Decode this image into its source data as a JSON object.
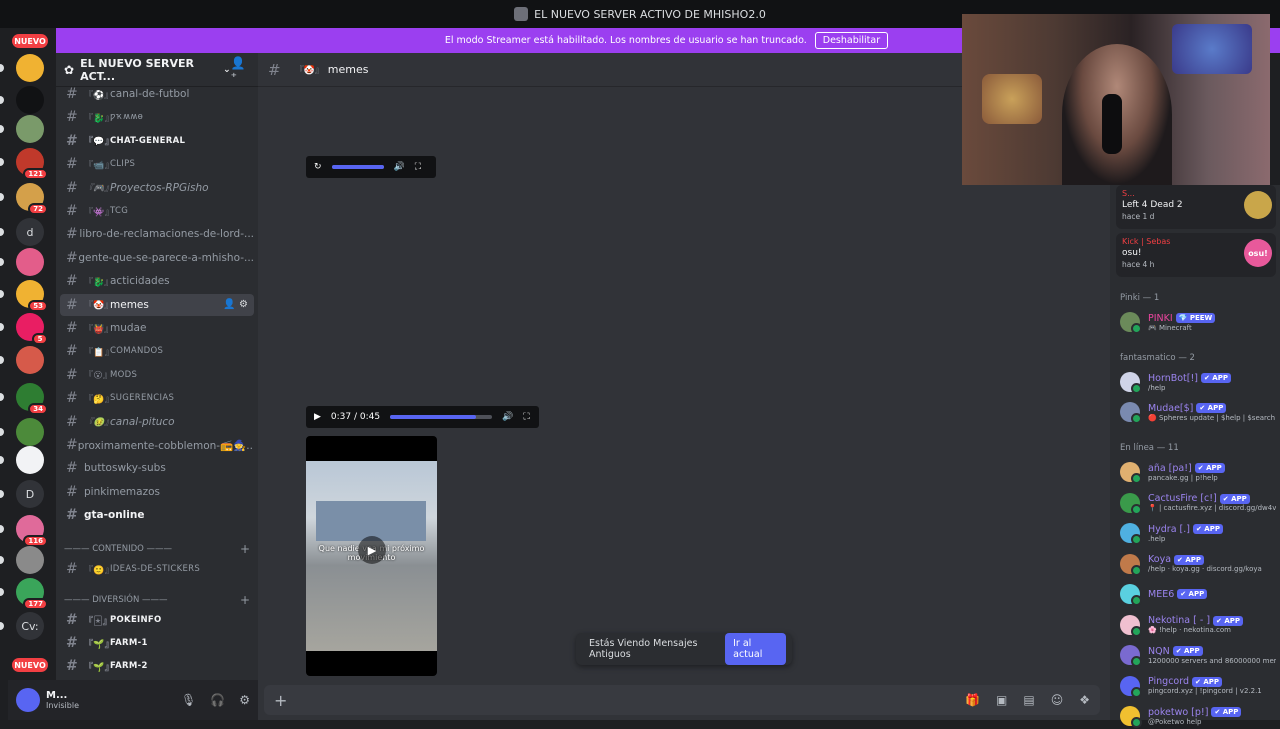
{
  "titlebar": {
    "title": "EL NUEVO SERVER ACTIVO DE MHISHO2.0"
  },
  "banner": {
    "text": "El modo Streamer está habilitado. Los nombres de usuario se han truncado.",
    "button": "Deshabilitar"
  },
  "rail": {
    "new_top": "NUEVO",
    "new_bottom": "NUEVO",
    "servers": [
      {
        "badge": "",
        "color": "#f0b232"
      },
      {
        "badge": "",
        "color": "#111214"
      },
      {
        "badge": "",
        "color": "#7a9a6a"
      },
      {
        "badge": "121",
        "color": "#c0392b"
      },
      {
        "badge": "72",
        "color": "#d4a04a"
      },
      {
        "badge": "",
        "letter": "d"
      },
      {
        "badge": "",
        "color": "#e35d8a"
      },
      {
        "badge": "53",
        "color": "#f0b232"
      },
      {
        "badge": "5",
        "color": "#e91e63"
      },
      {
        "badge": "",
        "color": "#d65a4a"
      },
      {
        "badge": "34",
        "color": "#2e7d32"
      },
      {
        "badge": "",
        "color": "#4c8a3a"
      },
      {
        "badge": "",
        "color": "#f2f3f5"
      },
      {
        "badge": "",
        "letter": "D"
      },
      {
        "badge": "116",
        "color": "#e06a9a"
      },
      {
        "badge": "",
        "color": "#8a8a8a"
      },
      {
        "badge": "177",
        "color": "#3aa55a"
      },
      {
        "badge": "",
        "letter": "Cv:"
      }
    ]
  },
  "sidebar": {
    "guild_name": "EL NUEVO SERVER ACT...",
    "channels": [
      {
        "emoji": "『⚽』",
        "name": "canal-de-futbol",
        "style": ""
      },
      {
        "emoji": "『🐉』",
        "name": "ƿҡʍʍѳ",
        "style": "small"
      },
      {
        "emoji": "『💬』",
        "name": "CHAT-GENERAL",
        "style": "bold small"
      },
      {
        "emoji": "『📹』",
        "name": "CLIPS",
        "style": "small"
      },
      {
        "emoji": "『🎮』",
        "name": "Proyectos-RPGisho",
        "style": "ital"
      },
      {
        "emoji": "『👾』",
        "name": "TCG",
        "style": "small"
      },
      {
        "emoji": "",
        "name": "libro-de-reclamaciones-de-lord-...",
        "style": ""
      },
      {
        "emoji": "",
        "name": "gente-que-se-parece-a-mhisho-...",
        "style": ""
      },
      {
        "emoji": "『🐉』",
        "name": "acticidades",
        "style": ""
      },
      {
        "emoji": "『🤡』",
        "name": "memes",
        "style": "sel"
      },
      {
        "emoji": "『👹』",
        "name": "mudae",
        "style": ""
      },
      {
        "emoji": "『📋』",
        "name": "COMANDOS",
        "style": "small"
      },
      {
        "emoji": "『😮』",
        "name": "MODS",
        "style": "small"
      },
      {
        "emoji": "『🤔』",
        "name": "SUGERENCIAS",
        "style": "small"
      },
      {
        "emoji": "『🤢』",
        "name": "canal-pituco",
        "style": "ital"
      },
      {
        "emoji": "",
        "name": "proximamente-cobblemon-📻🧙...",
        "style": ""
      },
      {
        "emoji": "",
        "name": "buttoswky-subs",
        "style": ""
      },
      {
        "emoji": "",
        "name": "pinkimemazos",
        "style": ""
      },
      {
        "emoji": "",
        "name": "gta-online",
        "style": "bold"
      }
    ],
    "category_contenido": "——— CONTENIDO ———",
    "contenido_channels": [
      {
        "emoji": "『🙂』",
        "name": "IDEAS-DE-STICKERS",
        "style": "small"
      }
    ],
    "category_diversion": "——— DIVERSIÓN ———",
    "diversion_channels": [
      {
        "emoji": "『🃏』",
        "name": "POKEINFO",
        "style": "bold small"
      },
      {
        "emoji": "『🌱』",
        "name": "FARM-1",
        "style": "bold small"
      },
      {
        "emoji": "『🌱』",
        "name": "FARM-2",
        "style": "bold small"
      }
    ]
  },
  "user": {
    "name": "M...",
    "status": "Invisible"
  },
  "channel": {
    "emoji": "『🤡』",
    "name": "memes"
  },
  "player_top": {},
  "player_mid": {
    "time": "0:37 / 0:45",
    "progress": 0.84
  },
  "video": {
    "caption": "Que nadie vea mi próximo movimiento"
  },
  "old_messages": {
    "text": "Estás Viendo Mensajes Antiguos",
    "button": "Ir al actual"
  },
  "composer": {
    "placeholder": ""
  },
  "activities": [
    {
      "who": "S...",
      "what": "Left 4 Dead 2",
      "when": "hace 1 d",
      "thumb_color": "#c9a64a"
    },
    {
      "who": "Kick | Sebas",
      "what": "osu!",
      "when": "hace 4 h",
      "thumb_color": "#e8599b",
      "thumb_text": "osu!"
    }
  ],
  "groups": {
    "pinki": "Pinki — 1",
    "fantasmatico": "fantasmatico — 2",
    "online": "En línea — 11"
  },
  "members_pinki": [
    {
      "name": "PINKI",
      "tag": "💎 PEEW",
      "sub": "🎮 Minecraft",
      "color": "#eb459e",
      "av": "#6b8a5a"
    }
  ],
  "members_fantasmatico": [
    {
      "name": "HornBot[!]",
      "tag": "✔ APP",
      "sub": "/help",
      "color": "#9b84ee",
      "av": "#d0d4e8"
    },
    {
      "name": "Mudae[$]",
      "tag": "✔ APP",
      "sub": "🔴 Spheres update | $help | $search",
      "color": "#9b84ee",
      "av": "#7a8ab0"
    }
  ],
  "members_online": [
    {
      "name": "aña [pa!]",
      "tag": "✔ APP",
      "sub": "pancake.gg | p!help",
      "color": "#9b84ee",
      "av": "#e0b070"
    },
    {
      "name": "CactusFire [c!]",
      "tag": "✔ APP",
      "sub": "📍 | cactusfire.xyz | discord.gg/dw4v",
      "color": "#9b84ee",
      "av": "#3a9a4a"
    },
    {
      "name": "Hydra [.]",
      "tag": "✔ APP",
      "sub": ".help",
      "color": "#9b84ee",
      "av": "#4fb0e0"
    },
    {
      "name": "Koya",
      "tag": "✔ APP",
      "sub": "/help · koya.gg · discord.gg/koya",
      "color": "#9b84ee",
      "av": "#c07a4a"
    },
    {
      "name": "MEE6",
      "tag": "✔ APP",
      "sub": "",
      "color": "#9b84ee",
      "av": "#5ad0e0"
    },
    {
      "name": "Nekotina [ - ]",
      "tag": "✔ APP",
      "sub": "🌸 !help · nekotina.com",
      "color": "#9b84ee",
      "av": "#f0c0d0"
    },
    {
      "name": "NQN",
      "tag": "✔ APP",
      "sub": "1200000 servers and 86000000 mem",
      "color": "#9b84ee",
      "av": "#7a6ad0"
    },
    {
      "name": "Pingcord",
      "tag": "✔ APP",
      "sub": "pingcord.xyz | !pingcord | v2.2.1",
      "color": "#9b84ee",
      "av": "#5865f2"
    },
    {
      "name": "poketwo [p!]",
      "tag": "✔ APP",
      "sub": "@Poketwo help",
      "color": "#9b84ee",
      "av": "#f0c030"
    }
  ],
  "colors": {
    "accent": "#5865f2",
    "streamer_banner": "#9b3ff0",
    "danger": "#f23f43",
    "online": "#23a55a"
  }
}
